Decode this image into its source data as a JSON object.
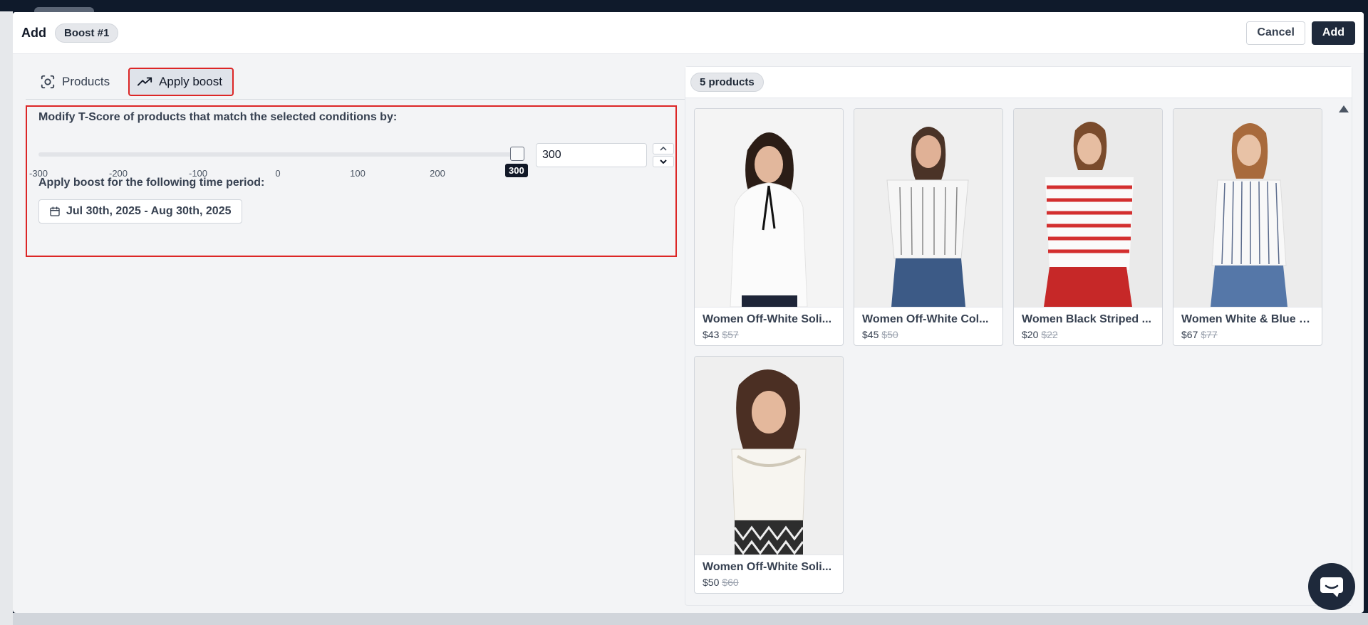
{
  "modal": {
    "title": "Add",
    "boost_badge": "Boost #1",
    "cancel_label": "Cancel",
    "add_label": "Add"
  },
  "tabs": [
    {
      "label": "Products",
      "icon": "scan-icon",
      "active": false
    },
    {
      "label": "Apply boost",
      "icon": "trending-up-icon",
      "active": true
    }
  ],
  "boost": {
    "modify_label": "Modify T-Score of products that match the selected conditions by:",
    "slider": {
      "min": -300,
      "max": 300,
      "value": 300,
      "ticks": [
        "-300",
        "-200",
        "-100",
        "0",
        "100",
        "200"
      ],
      "tooltip": "300"
    },
    "input_value": "300",
    "time_label": "Apply boost for the following time period:",
    "date_range": "Jul 30th, 2025 - Aug 30th, 2025"
  },
  "products": {
    "count_label": "5 products",
    "items": [
      {
        "title": "Women Off-White Soli...",
        "price": "$43",
        "old_price": "$57"
      },
      {
        "title": "Women Off-White Col...",
        "price": "$45",
        "old_price": "$50"
      },
      {
        "title": "Women Black Striped ...",
        "price": "$20",
        "old_price": "$22"
      },
      {
        "title": "Women White & Blue S...",
        "price": "$67",
        "old_price": "$77"
      },
      {
        "title": "Women Off-White Soli...",
        "price": "$50",
        "old_price": "$60"
      }
    ]
  },
  "colors": {
    "highlight": "#dc2626",
    "primary_button": "#1e293b"
  }
}
